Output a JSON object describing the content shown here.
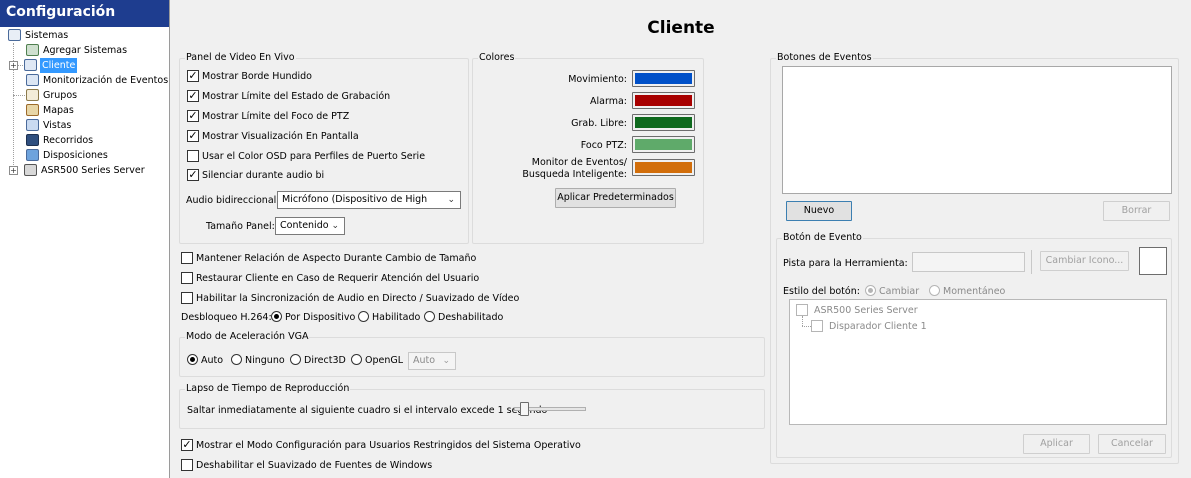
{
  "sidebar": {
    "title": "Configuración",
    "items": [
      {
        "label": "Sistemas",
        "icon": "server-rack-icon"
      },
      {
        "label": "Agregar Sistemas",
        "icon": "add-system-icon"
      },
      {
        "label": "Cliente",
        "icon": "client-settings-icon",
        "selected": true
      },
      {
        "label": "Monitorización de Eventos",
        "icon": "event-monitor-icon"
      },
      {
        "label": "Grupos",
        "icon": "groups-icon"
      },
      {
        "label": "Mapas",
        "icon": "map-icon"
      },
      {
        "label": "Vistas",
        "icon": "views-icon"
      },
      {
        "label": "Recorridos",
        "icon": "tours-icon"
      },
      {
        "label": "Disposiciones",
        "icon": "layouts-icon"
      },
      {
        "label": "ASR500 Series Server",
        "icon": "recorder-server-icon"
      }
    ]
  },
  "main": {
    "title": "Cliente",
    "live_video_panel": {
      "title": "Panel de Video En Vivo",
      "options": [
        {
          "label": "Mostrar Borde Hundido",
          "checked": true
        },
        {
          "label": "Mostrar Límite del Estado de Grabación",
          "checked": true
        },
        {
          "label": "Mostrar Límite del Foco de PTZ",
          "checked": true
        },
        {
          "label": "Mostrar Visualización En Pantalla",
          "checked": true
        },
        {
          "label": "Usar el Color OSD para Perfiles de Puerto Serie",
          "checked": false
        },
        {
          "label": "Silenciar durante audio bi",
          "checked": true
        }
      ],
      "audio_label": "Audio bidireccional:",
      "audio_value": "Micrófono (Dispositivo de High",
      "panel_size_label": "Tamaño Panel:",
      "panel_size_value": "Contenido"
    },
    "colors": {
      "title": "Colores",
      "items": [
        {
          "label": "Movimiento:",
          "color": "#0050c8"
        },
        {
          "label": "Alarma:",
          "color": "#a80000"
        },
        {
          "label": "Grab. Libre:",
          "color": "#0f6a1e"
        },
        {
          "label": "Foco PTZ:",
          "color": "#5faa6a"
        },
        {
          "label": "Monitor de Eventos/",
          "label2": "Busqueda Inteligente:",
          "color": "#d26e0a"
        }
      ],
      "apply_defaults": "Aplicar Predeterminados"
    },
    "general_options": [
      {
        "label": "Mantener Relación de Aspecto Durante Cambio de Tamaño",
        "checked": false
      },
      {
        "label": "Restaurar Cliente en Caso de Requerir Atención del Usuario",
        "checked": false
      },
      {
        "label": "Habilitar la Sincronización de Audio en Directo / Suavizado de Vídeo",
        "checked": false
      }
    ],
    "h264": {
      "label": "Desbloqueo H.264:",
      "options": [
        "Por Dispositivo",
        "Habilitado",
        "Deshabilitado"
      ],
      "selected": "Por Dispositivo"
    },
    "vga": {
      "title": "Modo de Aceleración VGA",
      "options": [
        "Auto",
        "Ninguno",
        "Direct3D",
        "OpenGL"
      ],
      "selected": "Auto",
      "select_value": "Auto"
    },
    "playback": {
      "title": "Lapso de Tiempo de Reproducción",
      "text": "Saltar inmediatamente al siguiente cuadro si el intervalo excede 1 segundo",
      "slider_value": 0.1
    },
    "bottom_options": [
      {
        "label": "Mostrar el Modo Configuración para Usuarios Restringidos del Sistema Operativo",
        "checked": true
      },
      {
        "label": "Deshabilitar el Suavizado de Fuentes de Windows",
        "checked": false
      }
    ],
    "event_buttons": {
      "title": "Botones de Eventos",
      "new_label": "Nuevo",
      "delete_label": "Borrar",
      "event_button_group": {
        "title": "Botón de Evento",
        "tooltip_label": "Pista para la Herramienta:",
        "change_icon_label": "Cambiar Icono...",
        "button_style_label": "Estilo del botón:",
        "style_options": [
          "Cambiar",
          "Momentáneo"
        ],
        "style_selected": "Cambiar",
        "tree": [
          {
            "label": "ASR500 Series Server"
          },
          {
            "label": "Disparador Cliente 1"
          }
        ],
        "apply_label": "Aplicar",
        "cancel_label": "Cancelar"
      }
    }
  }
}
